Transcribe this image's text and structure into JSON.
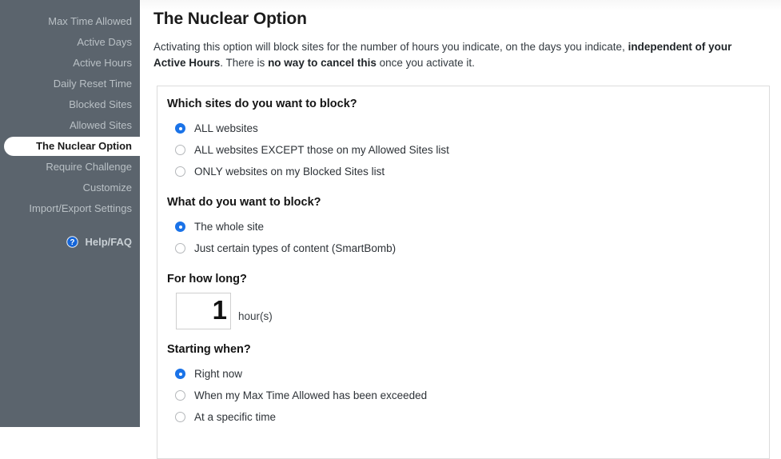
{
  "sidebar": {
    "items": [
      {
        "label": "Max Time Allowed",
        "active": false
      },
      {
        "label": "Active Days",
        "active": false
      },
      {
        "label": "Active Hours",
        "active": false
      },
      {
        "label": "Daily Reset Time",
        "active": false
      },
      {
        "label": "Blocked Sites",
        "active": false
      },
      {
        "label": "Allowed Sites",
        "active": false
      },
      {
        "label": "The Nuclear Option",
        "active": true
      },
      {
        "label": "Require Challenge",
        "active": false
      },
      {
        "label": "Customize",
        "active": false
      },
      {
        "label": "Import/Export Settings",
        "active": false
      }
    ],
    "help": {
      "label": "Help/FAQ",
      "icon": "question-mark-circle-icon"
    },
    "colors": {
      "background": "#5b646d",
      "item_text": "#b9c0c5",
      "active_pill_background": "#ffffff",
      "active_item_text": "#1a1a1a",
      "help_icon": "#1a73e8"
    }
  },
  "main": {
    "title": "The Nuclear Option",
    "description_part1": "Activating this option will block sites for the number of hours you indicate, on the days you indicate, ",
    "description_bold1": "independent of your Active Hours",
    "description_part2": ". There is ",
    "description_bold2": "no way to cancel this",
    "description_part3": " once you activate it."
  },
  "panel": {
    "sections": [
      {
        "title": "Which sites do you want to block?",
        "type": "radio-group",
        "options": [
          {
            "label": "ALL websites",
            "selected": true
          },
          {
            "label": "ALL websites EXCEPT those on my Allowed Sites list",
            "selected": false
          },
          {
            "label": "ONLY websites on my Blocked Sites list",
            "selected": false
          }
        ]
      },
      {
        "title": "What do you want to block?",
        "type": "radio-group",
        "options": [
          {
            "label": "The whole site",
            "selected": true
          },
          {
            "label": "Just certain types of content (SmartBomb)",
            "selected": false
          }
        ]
      },
      {
        "title": "For how long?",
        "type": "number-field",
        "value": "1",
        "unit": "hour(s)"
      },
      {
        "title": "Starting when?",
        "type": "radio-group",
        "options": [
          {
            "label": "Right now",
            "selected": true
          },
          {
            "label": "When my Max Time Allowed has been exceeded",
            "selected": false
          },
          {
            "label": "At a specific time",
            "selected": false
          }
        ]
      }
    ],
    "colors": {
      "border": "#dcdcdc",
      "radio_selected": "#1a73e8",
      "radio_unselected_border": "#b4b7ba"
    }
  }
}
